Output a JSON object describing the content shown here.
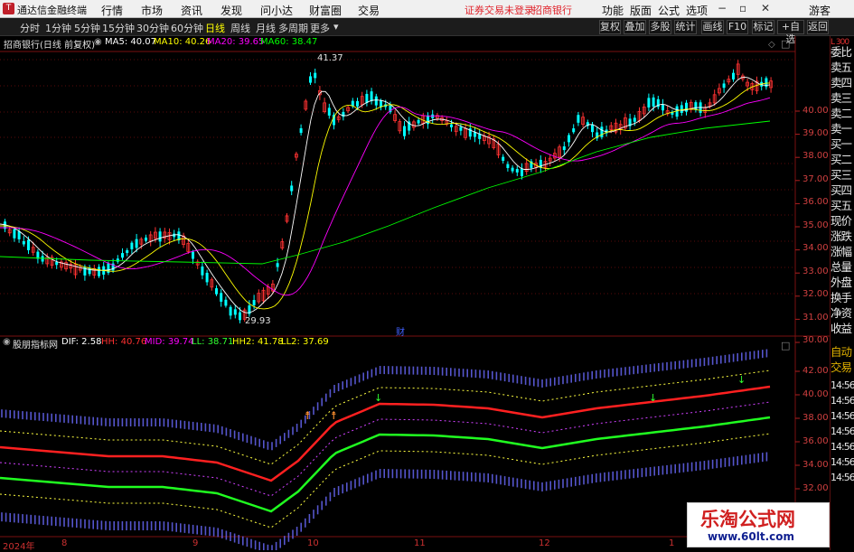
{
  "app": {
    "title": "通达信金融终端",
    "logo_text": "T"
  },
  "menu": [
    "行情",
    "市场",
    "资讯",
    "发现",
    "问小达",
    "财富圈",
    "交易"
  ],
  "login_status": "证券交易未登录",
  "broker": "招商银行",
  "menu_right": [
    "功能",
    "版面",
    "公式",
    "选项"
  ],
  "guest": "游客",
  "timeframes": [
    "分时",
    "1分钟",
    "5分钟",
    "15分钟",
    "30分钟",
    "60分钟",
    "日线",
    "周线",
    "月线",
    "多周期",
    "更多"
  ],
  "active_timeframe": "日线",
  "toolbar_buttons": [
    "复权",
    "叠加",
    "多股",
    "统计",
    "画线",
    "F10",
    "标记",
    "+自选",
    "返回"
  ],
  "main_info": {
    "stock": "招商银行(日线 前复权)",
    "ma5": "MA5: 40.07",
    "ma10": "MA10: 40.26",
    "ma20": "MA20: 39.65",
    "ma60": "MA60: 38.47"
  },
  "sub_info": {
    "name": "股朋指标网",
    "dif": "DIF: 2.58",
    "hh": "HH: 40.76",
    "mid": "MID: 39.74",
    "ll": "LL: 38.71",
    "hh2": "HH2: 41.78",
    "ll2": "LL2: 37.69"
  },
  "annotations": {
    "high": "41.37",
    "low": "29.93",
    "finance_marker": "财"
  },
  "y_axis_main": [
    "40.00",
    "39.00",
    "38.00",
    "37.00",
    "36.00",
    "35.00",
    "34.00",
    "33.00",
    "32.00",
    "31.00",
    "30.00"
  ],
  "y_axis_sub": [
    "42.00",
    "40.00",
    "38.00",
    "36.00",
    "34.00",
    "32.00"
  ],
  "x_axis": [
    "2024年",
    "8",
    "9",
    "10",
    "11",
    "12",
    "1"
  ],
  "sidebar": [
    "委比",
    "卖五",
    "卖四",
    "卖三",
    "卖二",
    "卖一",
    "买一",
    "买二",
    "买三",
    "买四",
    "买五",
    "现价",
    "涨跌",
    "涨幅",
    "总量",
    "外盘",
    "换手",
    "净资",
    "收益",
    "自动",
    "交易",
    "14:56",
    "14:56",
    "14:56",
    "14:56",
    "14:56",
    "14:56",
    "14:56"
  ],
  "sidebar_top": "L 300",
  "watermark": {
    "line1": "乐淘公式网",
    "line2": "www.60lt.com"
  },
  "colors": {
    "up": "#ff3232",
    "down": "#00ffff",
    "ma5": "#ffffff",
    "ma10": "#ffff00",
    "ma20": "#ff00ff",
    "ma60": "#00ff00",
    "band_red": "#ff2020",
    "band_green": "#20ff20",
    "band_blue": "#6a6aff"
  }
}
